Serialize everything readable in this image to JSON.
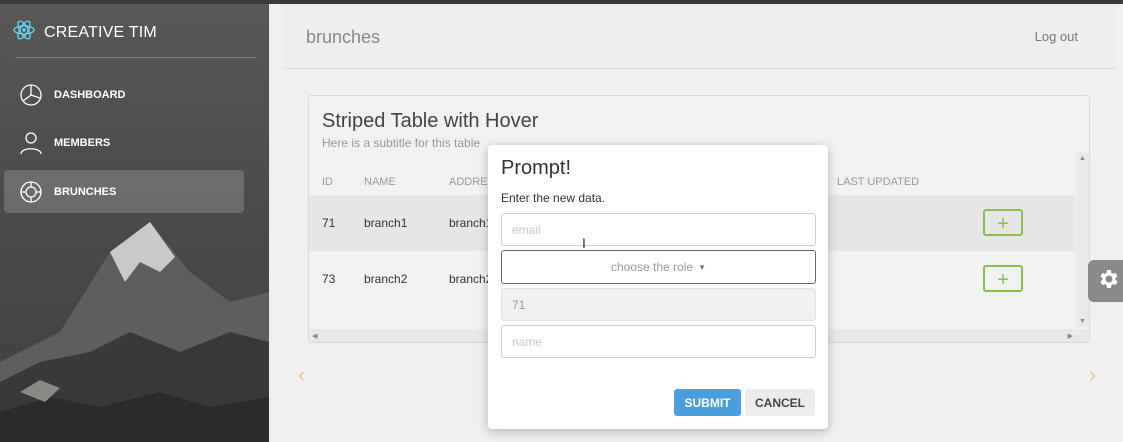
{
  "sidebar": {
    "brand": "CREATIVE TIM",
    "items": [
      {
        "label": "DASHBOARD",
        "icon": "pie-chart-icon"
      },
      {
        "label": "MEMBERS",
        "icon": "user-icon"
      },
      {
        "label": "BRUNCHES",
        "icon": "target-icon",
        "active": true
      }
    ]
  },
  "header": {
    "title": "brunches",
    "logout": "Log out"
  },
  "card": {
    "title": "Striped Table with Hover",
    "subtitle": "Here is a subtitle for this table",
    "columns": [
      "ID",
      "NAME",
      "ADDRESS",
      "LAST UPDATED"
    ],
    "rows": [
      {
        "id": "71",
        "name": "branch1",
        "address": "branch1"
      },
      {
        "id": "73",
        "name": "branch2",
        "address": "branch2"
      }
    ],
    "add_symbol": "+"
  },
  "pagination": {
    "prev": "‹",
    "next": "›"
  },
  "modal": {
    "title": "Prompt!",
    "description": "Enter the new data.",
    "email_placeholder": "email",
    "role_placeholder": "choose the role",
    "id_value": "71",
    "name_placeholder": "name",
    "submit": "SUBMIT",
    "cancel": "CANCEL"
  },
  "colors": {
    "accent_green": "#87c04a",
    "submit_blue": "#4aa0de",
    "react_logo": "#61dafb"
  }
}
